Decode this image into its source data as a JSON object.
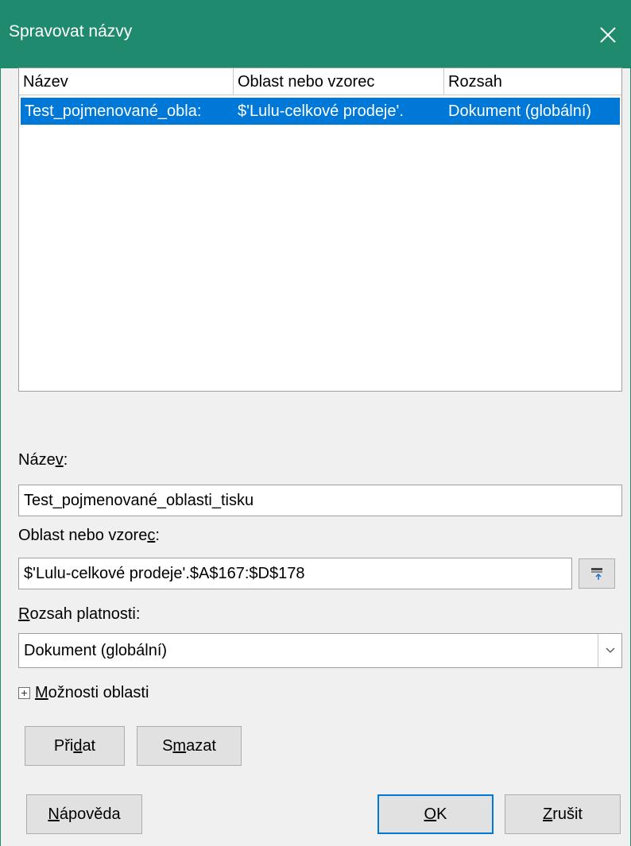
{
  "window": {
    "title": "Spravovat názvy",
    "accent": "#1f8a6e"
  },
  "list": {
    "headers": [
      "Název",
      "Oblast nebo vzorec",
      "Rozsah"
    ],
    "rows": [
      {
        "name": "Test_pojmenované_obla:",
        "range": "$'Lulu-celkové prodeje'.",
        "scope": "Dokument (globální)",
        "selected": true
      }
    ],
    "selection_color": "#0078d7"
  },
  "form": {
    "name_label_pre": "Náze",
    "name_label_ul": "v",
    "name_label_post": ":",
    "name_value": "Test_pojmenované_oblasti_tisku",
    "range_label_pre": "Oblast nebo vzore",
    "range_label_ul": "c",
    "range_label_post": ":",
    "range_value": "$'Lulu-celkové prodeje'.$A$167:$D$178",
    "scope_label_ul": "R",
    "scope_label_post": "ozsah platnosti:",
    "scope_value": "Dokument (globální)",
    "options_ul": "M",
    "options_post": "ožnosti oblasti"
  },
  "buttons": {
    "add_pre": "Při",
    "add_ul": "d",
    "add_post": "at",
    "delete_pre": "S",
    "delete_ul": "m",
    "delete_post": "azat",
    "help_ul": "N",
    "help_post": "ápověda",
    "ok_ul": "O",
    "ok_post": "K",
    "cancel_ul": "Z",
    "cancel_post": "rušit"
  }
}
